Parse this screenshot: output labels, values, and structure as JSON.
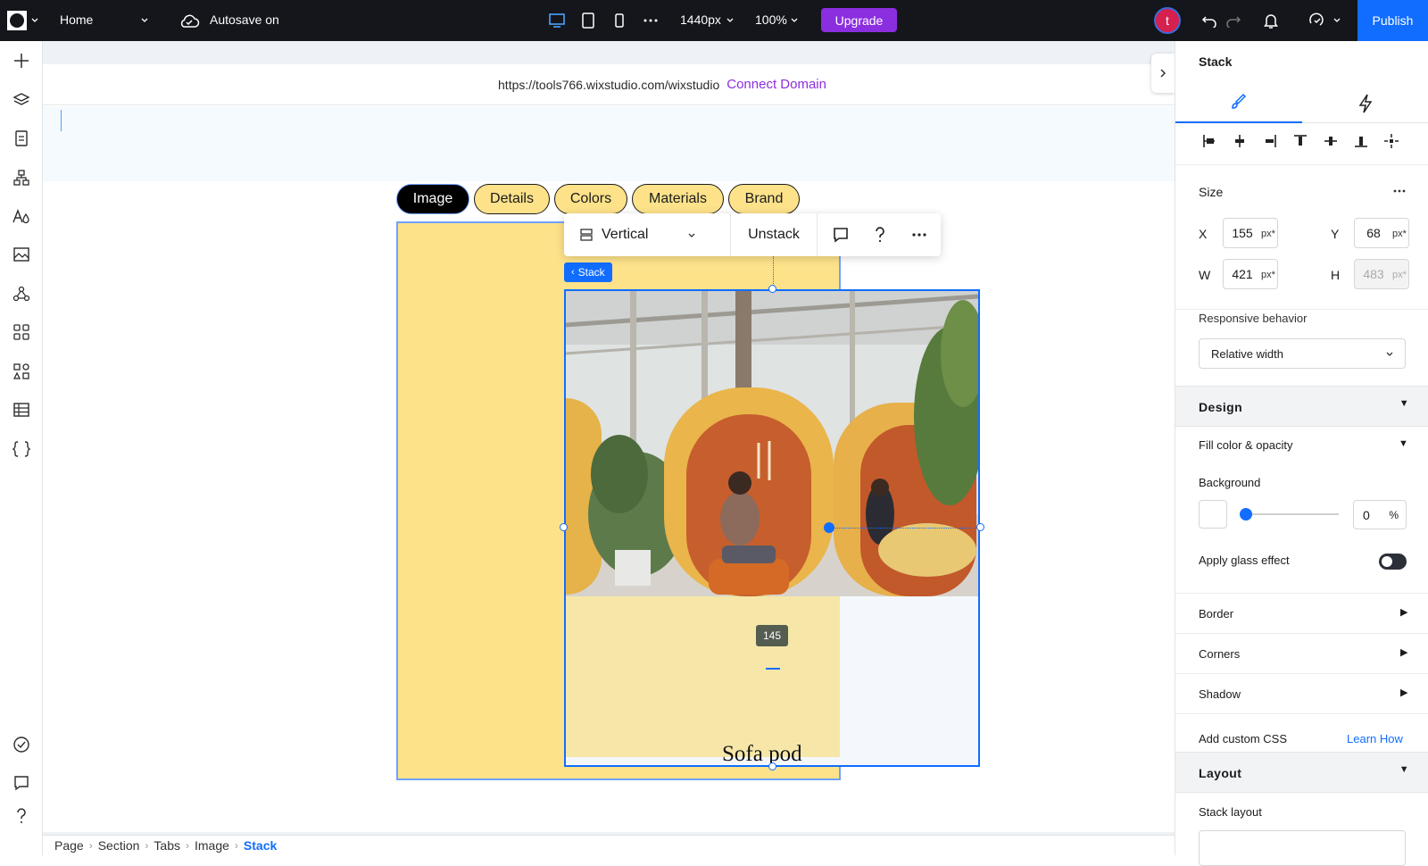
{
  "topbar": {
    "page_name": "Home",
    "autosave": "Autosave on",
    "width_value": "1440px",
    "zoom": "100%",
    "upgrade_label": "Upgrade",
    "publish_label": "Publish",
    "avatar_letter": "t"
  },
  "canvas": {
    "url": "https://tools766.wixstudio.com/wixstudio",
    "connect_domain": "Connect Domain",
    "tabs": [
      "Image",
      "Details",
      "Colors",
      "Materials",
      "Brand"
    ],
    "active_tab": "Image",
    "floating_toolbar": {
      "direction": "Vertical",
      "unstack": "Unstack"
    },
    "stack_label": "Stack",
    "spacing_badge": "145",
    "product_name": "Sofa pod"
  },
  "breadcrumb": [
    "Page",
    "Section",
    "Tabs",
    "Image",
    "Stack"
  ],
  "inspector": {
    "title": "Stack",
    "size_label": "Size",
    "x_label": "X",
    "x_value": "155",
    "y_label": "Y",
    "y_value": "68",
    "w_label": "W",
    "w_value": "421",
    "h_label": "H",
    "h_value": "483",
    "unit": "px*",
    "responsive_label": "Responsive behavior",
    "responsive_value": "Relative width",
    "design_label": "Design",
    "fill_label": "Fill color & opacity",
    "background_label": "Background",
    "opacity_value": "0",
    "opacity_unit": "%",
    "glass_label": "Apply glass effect",
    "border_label": "Border",
    "corners_label": "Corners",
    "shadow_label": "Shadow",
    "custom_css_label": "Add custom CSS",
    "learn_how": "Learn How",
    "layout_label": "Layout",
    "stack_layout_label": "Stack layout"
  },
  "colors": {
    "accent": "#116dff",
    "upgrade": "#8b2ee0",
    "tab_fill": "#fde28a"
  }
}
